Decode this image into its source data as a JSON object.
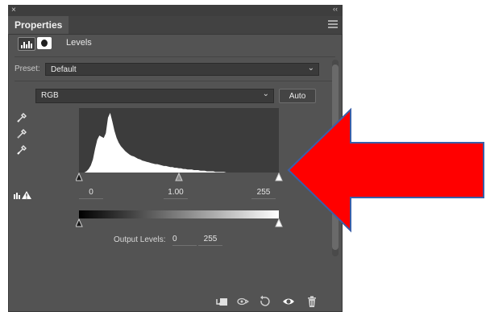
{
  "window": {
    "close_glyph": "×",
    "collapse_glyph": "‹‹"
  },
  "panel": {
    "tab_label": "Properties",
    "menu_icon": "panel-menu-icon"
  },
  "header": {
    "title": "Levels",
    "adjustment_icon": "levels-adjustment-icon",
    "mask_icon": "layer-mask-icon"
  },
  "preset": {
    "label": "Preset:",
    "value": "Default"
  },
  "channel": {
    "value": "RGB"
  },
  "auto_button": {
    "label": "Auto"
  },
  "input_levels": {
    "black": "0",
    "gamma": "1.00",
    "white": "255"
  },
  "output_levels": {
    "label": "Output Levels:",
    "black": "0",
    "white": "255"
  },
  "tools": [
    "black-point-eyedropper-icon",
    "gray-point-eyedropper-icon",
    "white-point-eyedropper-icon"
  ],
  "bottom_toolbar": [
    "clip-to-layer-icon",
    "view-previous-state-icon",
    "reset-icon",
    "toggle-visibility-icon",
    "delete-icon"
  ],
  "annotation": {
    "arrow_color": "#ff0000",
    "arrow_outline": "#3a5fa8"
  },
  "histogram": {
    "description_values": [
      0,
      0,
      2,
      6,
      12,
      22,
      40,
      55,
      62,
      60,
      58,
      66,
      92,
      100,
      86,
      70,
      58,
      50,
      44,
      40,
      36,
      33,
      30,
      28,
      27,
      25,
      23,
      22,
      20,
      19,
      18,
      17,
      16,
      15,
      14,
      14,
      13,
      12,
      11,
      11,
      10,
      9,
      9,
      8,
      8,
      7,
      7,
      6,
      6,
      5,
      5,
      5,
      4,
      4,
      4,
      3,
      3,
      3,
      2,
      2,
      2,
      2,
      1,
      1,
      1,
      1,
      1,
      0,
      0,
      0
    ]
  }
}
